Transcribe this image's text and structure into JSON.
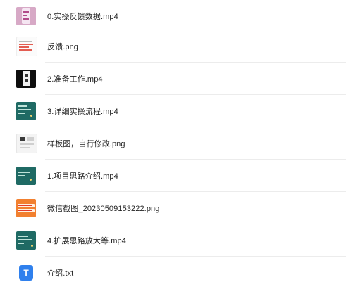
{
  "files": [
    {
      "name": "0.实操反馈数据.mp4",
      "thumb": "video-thumbnail-pink"
    },
    {
      "name": "反馈.png",
      "thumb": "image-thumbnail-document"
    },
    {
      "name": "2.准备工作.mp4",
      "thumb": "video-thumbnail-dark"
    },
    {
      "name": "3.详细实操流程.mp4",
      "thumb": "video-thumbnail-teal"
    },
    {
      "name": "样板图，自行修改.png",
      "thumb": "image-thumbnail-sample"
    },
    {
      "name": "1.项目思路介绍.mp4",
      "thumb": "video-thumbnail-teal"
    },
    {
      "name": "微信截图_20230509153222.png",
      "thumb": "image-thumbnail-orange"
    },
    {
      "name": "4.扩展思路放大等.mp4",
      "thumb": "video-thumbnail-teal"
    },
    {
      "name": "介绍.txt",
      "thumb": "txt-file-icon",
      "icon_letter": "T",
      "icon_color": "#2f80ed"
    }
  ]
}
